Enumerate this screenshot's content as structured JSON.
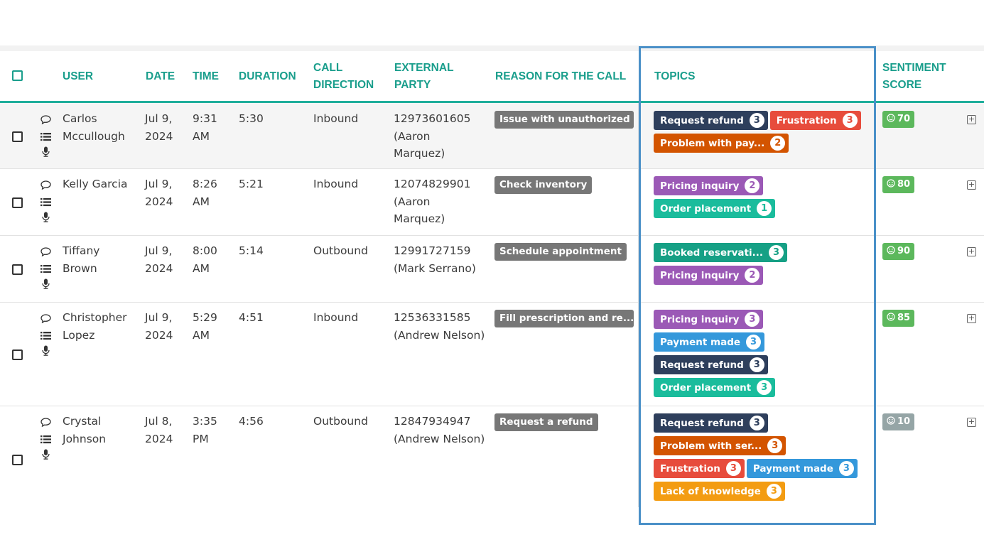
{
  "headers": {
    "user": "USER",
    "date": "DATE",
    "time": "TIME",
    "duration": "DURATION",
    "call_direction": [
      "CALL",
      "DIRECTION"
    ],
    "external_party": [
      "EXTERNAL",
      "PARTY"
    ],
    "reason": "REASON FOR THE CALL",
    "topics": "TOPICS",
    "sentiment": [
      "SENTIMENT",
      "SCORE"
    ]
  },
  "colors": {
    "accent": "#1a9e8c",
    "highlight_border": "#4a90c8",
    "request_refund": "#2e3f5c",
    "frustration": "#e74c3c",
    "problem": "#d35400",
    "pricing_inquiry": "#9b59b6",
    "order_placement": "#1abc9c",
    "booked": "#16a085",
    "payment_made": "#3498db",
    "lack_of_knowledge": "#f39c12",
    "sentiment_good": "#5cb85c",
    "sentiment_neutral": "#95a5a6"
  },
  "rows": [
    {
      "user": [
        "Carlos",
        "Mccullough"
      ],
      "date": [
        "Jul 9,",
        "2024"
      ],
      "time": [
        "9:31",
        "AM"
      ],
      "duration": "5:30",
      "direction": "Inbound",
      "party": [
        "12973601605",
        "(Aaron",
        "Marquez)"
      ],
      "reason": "Issue with unauthorized ...",
      "topics": [
        {
          "label": "Request refund",
          "count": "3",
          "color": "#2e3f5c"
        },
        {
          "label": "Frustration",
          "count": "3",
          "color": "#e74c3c"
        },
        {
          "label": "Problem with pay...",
          "count": "2",
          "color": "#d35400"
        }
      ],
      "sentiment": "70",
      "sentiment_color": "#5cb85c"
    },
    {
      "user": [
        "Kelly Garcia"
      ],
      "date": [
        "Jul 9,",
        "2024"
      ],
      "time": [
        "8:26",
        "AM"
      ],
      "duration": "5:21",
      "direction": "Inbound",
      "party": [
        "12074829901",
        "(Aaron",
        "Marquez)"
      ],
      "reason": "Check inventory",
      "topics": [
        {
          "label": "Pricing inquiry",
          "count": "2",
          "color": "#9b59b6"
        },
        {
          "label": "Order placement",
          "count": "1",
          "color": "#1abc9c"
        }
      ],
      "sentiment": "80",
      "sentiment_color": "#5cb85c"
    },
    {
      "user": [
        "Tiffany",
        "Brown"
      ],
      "date": [
        "Jul 9,",
        "2024"
      ],
      "time": [
        "8:00",
        "AM"
      ],
      "duration": "5:14",
      "direction": "Outbound",
      "party": [
        "12991727159",
        "(Mark Serrano)"
      ],
      "reason": "Schedule appointment",
      "topics": [
        {
          "label": "Booked reservati...",
          "count": "3",
          "color": "#16a085"
        },
        {
          "label": "Pricing inquiry",
          "count": "2",
          "color": "#9b59b6"
        }
      ],
      "sentiment": "90",
      "sentiment_color": "#5cb85c"
    },
    {
      "user": [
        "Christopher",
        "Lopez"
      ],
      "date": [
        "Jul 9,",
        "2024"
      ],
      "time": [
        "5:29",
        "AM"
      ],
      "duration": "4:51",
      "direction": "Inbound",
      "party": [
        "12536331585",
        "(Andrew Nelson)"
      ],
      "reason": "Fill prescription and re...",
      "topics": [
        {
          "label": "Pricing inquiry",
          "count": "3",
          "color": "#9b59b6"
        },
        {
          "label": "Payment made",
          "count": "3",
          "color": "#3498db"
        },
        {
          "label": "Request refund",
          "count": "3",
          "color": "#2e3f5c"
        },
        {
          "label": "Order placement",
          "count": "3",
          "color": "#1abc9c"
        }
      ],
      "sentiment": "85",
      "sentiment_color": "#5cb85c"
    },
    {
      "user": [
        "Crystal",
        "Johnson"
      ],
      "date": [
        "Jul 8,",
        "2024"
      ],
      "time": [
        "3:35",
        "PM"
      ],
      "duration": "4:56",
      "direction": "Outbound",
      "party": [
        "12847934947",
        "(Andrew Nelson)"
      ],
      "reason": "Request a refund",
      "topics": [
        {
          "label": "Request refund",
          "count": "3",
          "color": "#2e3f5c"
        },
        {
          "label": "Problem with ser...",
          "count": "3",
          "color": "#d35400"
        },
        {
          "label": "Frustration",
          "count": "3",
          "color": "#e74c3c"
        },
        {
          "label": "Payment made",
          "count": "3",
          "color": "#3498db"
        },
        {
          "label": "Lack of knowledge",
          "count": "3",
          "color": "#f39c12"
        }
      ],
      "sentiment": "10",
      "sentiment_color": "#95a5a6"
    }
  ],
  "icons": {
    "comment": "comment-icon",
    "list": "list-icon",
    "mic": "microphone-icon",
    "smile": "smile-icon",
    "expand": "expand-icon"
  }
}
